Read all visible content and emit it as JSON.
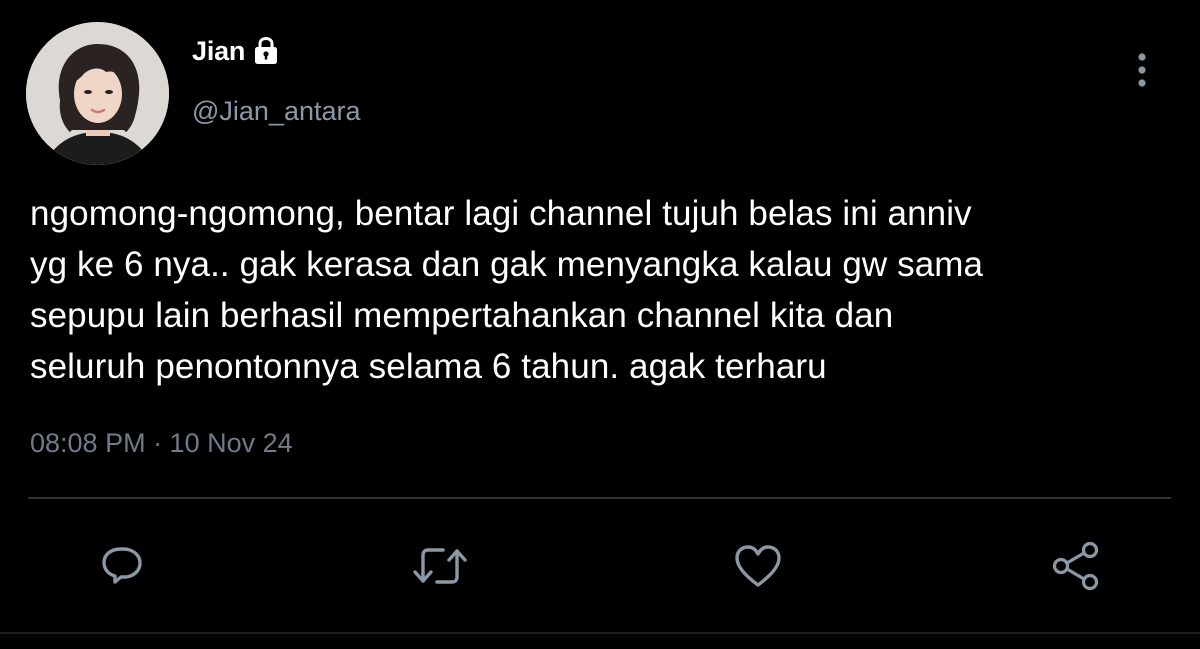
{
  "user": {
    "display_name": "Jian",
    "handle": "@Jian_antara",
    "protected_icon": "lock-icon",
    "avatar": "avatar-photo"
  },
  "tweet": {
    "lines": [
      "ngomong-ngomong, bentar lagi channel tujuh belas ini anniv",
      "yg ke 6 nya.. gak kerasa dan gak menyangka kalau gw sama",
      "sepupu lain berhasil mempertahankan channel kita dan",
      "seluruh penontonnya selama 6 tahun. agak terharu"
    ],
    "timestamp": "08:08 PM · 10 Nov 24"
  },
  "actions": {
    "reply_icon": "reply-icon",
    "retweet_icon": "retweet-icon",
    "like_icon": "heart-icon",
    "share_icon": "share-icon",
    "more_icon": "more-vertical-icon"
  },
  "colors": {
    "background": "#000000",
    "primary_text": "#ffffff",
    "secondary_text": "#8b98a5",
    "icon": "#8b98a5",
    "divider": "#2f3336"
  }
}
